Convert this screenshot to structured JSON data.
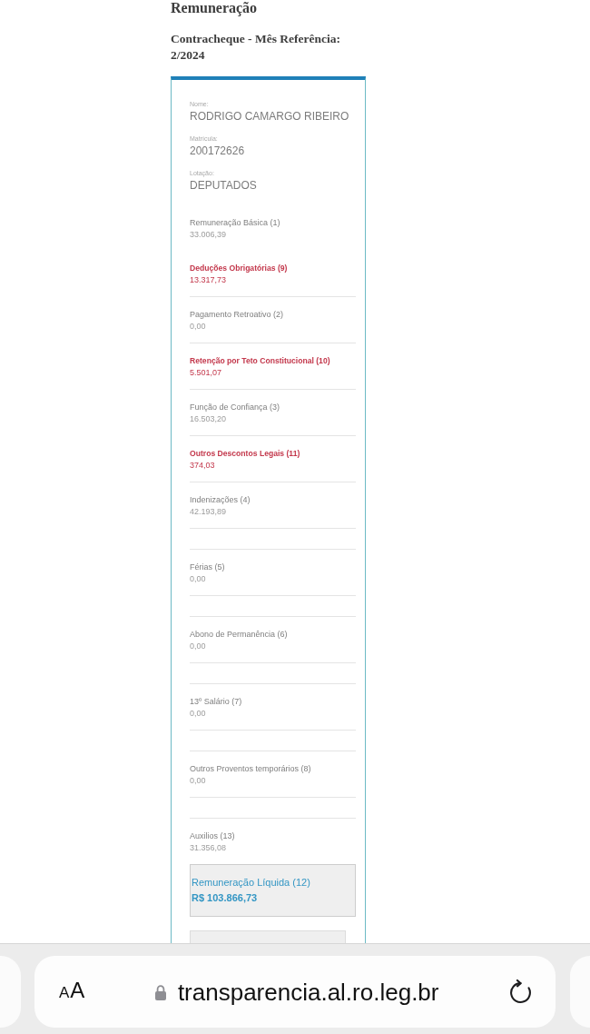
{
  "page": {
    "title": "Remuneração",
    "subtitle": "Contracheque - Mês Referência: 2/2024"
  },
  "payslip": {
    "fields": [
      {
        "label": "Nome:",
        "value": "RODRIGO CAMARGO RIBEIRO"
      },
      {
        "label": "Matrícula:",
        "value": "200172626"
      },
      {
        "label": "Lotação:",
        "value": "DEPUTADOS"
      }
    ],
    "groups": [
      [
        {
          "kind": "earning",
          "label": "Remuneração Básica (1)",
          "value": "33.006,39"
        },
        {
          "kind": "deduction",
          "label": "Deduções Obrigatórias (9)",
          "value": "13.317,73"
        }
      ],
      [
        {
          "kind": "earning",
          "label": "Pagamento Retroativo (2)",
          "value": "0,00"
        }
      ],
      [
        {
          "kind": "deduction",
          "label": "Retenção por Teto Constitucional (10)",
          "value": "5.501,07"
        }
      ],
      [
        {
          "kind": "earning",
          "label": "Função de Confiança (3)",
          "value": "16.503,20"
        }
      ],
      [
        {
          "kind": "deduction",
          "label": "Outros Descontos Legais (11)",
          "value": "374,03"
        }
      ],
      [
        {
          "kind": "earning",
          "label": "Indenizações (4)",
          "value": "42.193,89"
        }
      ],
      [
        {
          "kind": "blank"
        }
      ],
      [
        {
          "kind": "earning",
          "label": "Férias (5)",
          "value": "0,00"
        }
      ],
      [
        {
          "kind": "blank"
        }
      ],
      [
        {
          "kind": "earning",
          "label": "Abono de Permanência (6)",
          "value": "0,00"
        }
      ],
      [
        {
          "kind": "blank"
        }
      ],
      [
        {
          "kind": "earning",
          "label": "13º Salário (7)",
          "value": "0,00"
        }
      ],
      [
        {
          "kind": "blank"
        }
      ],
      [
        {
          "kind": "earning",
          "label": "Outros Proventos temporários (8)",
          "value": "0,00"
        }
      ],
      [
        {
          "kind": "blank"
        }
      ],
      [
        {
          "kind": "earning",
          "label": "Auxilios (13)",
          "value": "31.356,08"
        }
      ]
    ],
    "net_pay": {
      "label": "Remuneração Líquida (12)",
      "value": "R$ 103.866,73"
    }
  },
  "browser": {
    "text_size_button": "AA",
    "secure": true,
    "url": "transparencia.al.ro.leg.br"
  }
}
